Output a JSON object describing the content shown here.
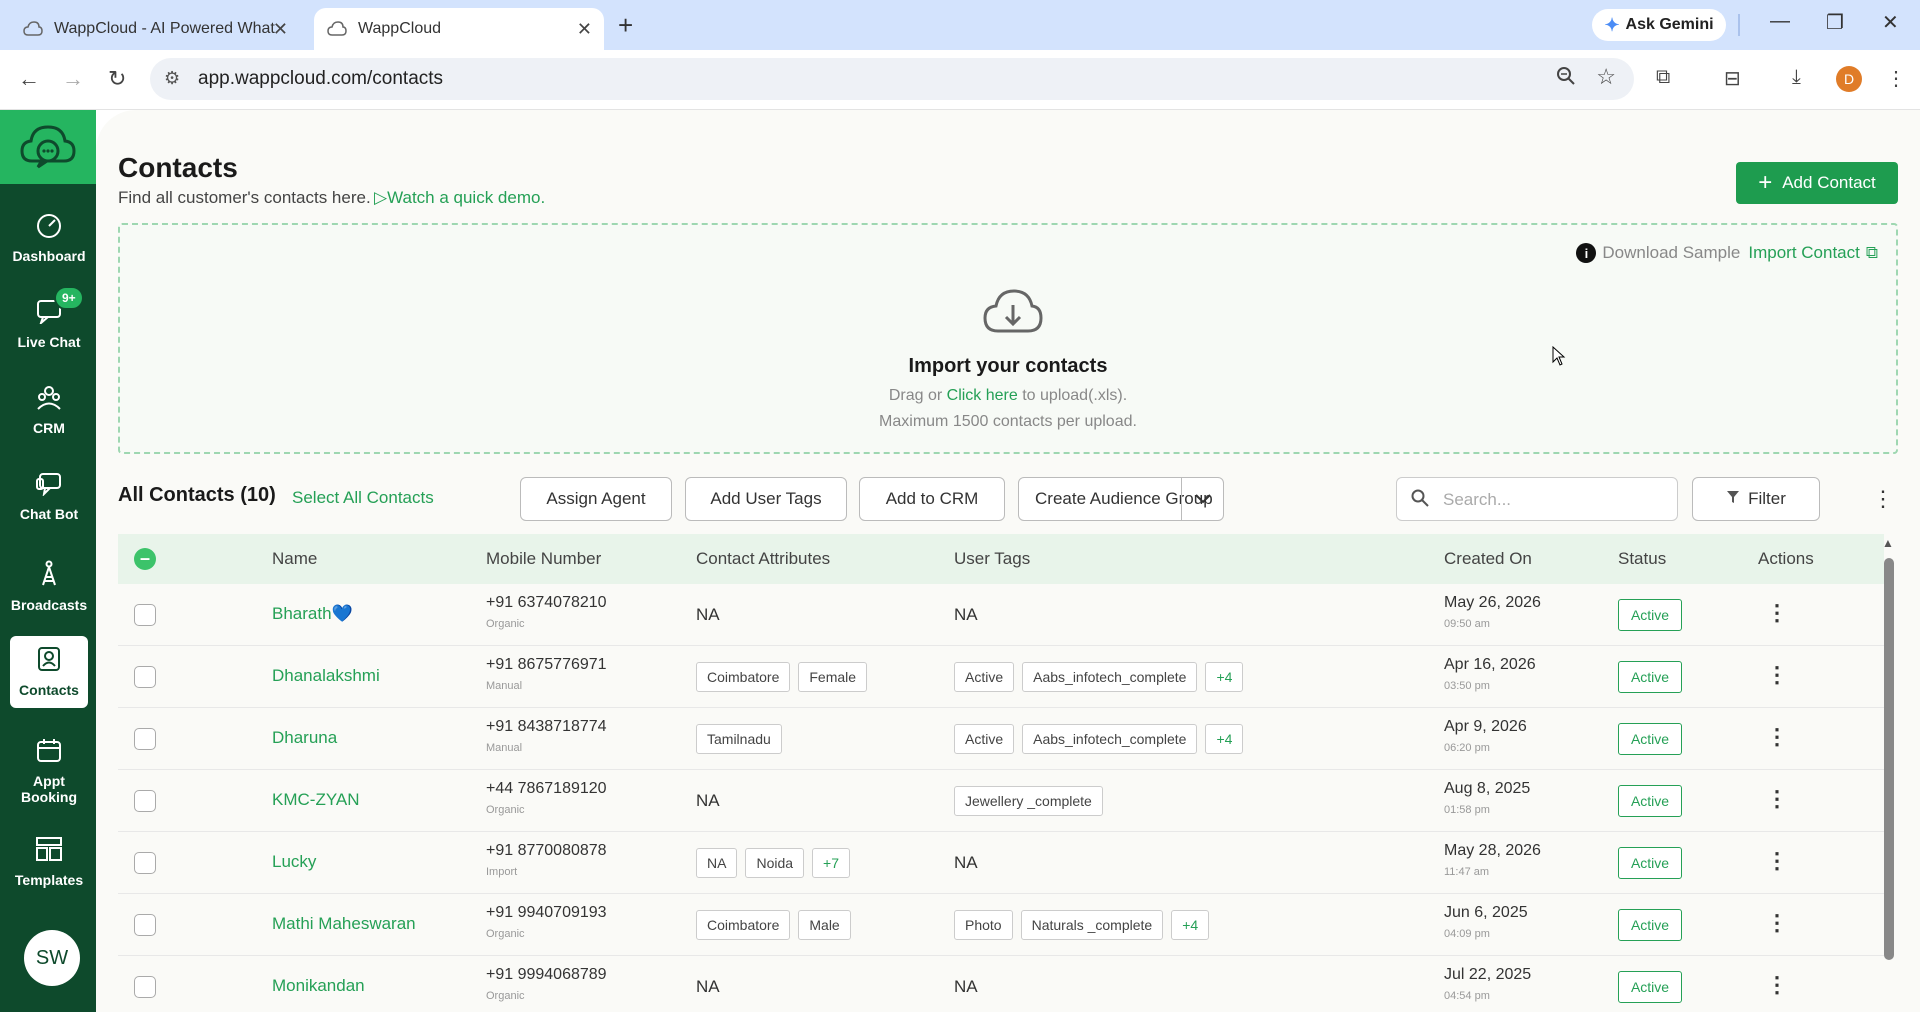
{
  "browser": {
    "tabs": [
      {
        "title": "WappCloud - AI Powered What"
      },
      {
        "title": "WappCloud"
      }
    ],
    "ask_gemini": "Ask Gemini",
    "url": "app.wappcloud.com/contacts",
    "profile_initial": "D"
  },
  "sidebar": {
    "items": [
      {
        "label": "Dashboard",
        "icon": "gauge-icon"
      },
      {
        "label": "Live Chat",
        "icon": "chat-icon",
        "badge": "9+"
      },
      {
        "label": "CRM",
        "icon": "people-icon"
      },
      {
        "label": "Chat Bot",
        "icon": "bot-icon"
      },
      {
        "label": "Broadcasts",
        "icon": "tower-icon"
      },
      {
        "label": "Contacts",
        "icon": "contacts-icon",
        "active": true
      },
      {
        "label": "Appt Booking",
        "icon": "calendar-icon"
      },
      {
        "label": "Templates",
        "icon": "grid-icon"
      }
    ],
    "avatar": "SW"
  },
  "header": {
    "title": "Contacts",
    "subtitle": "Find all customer's contacts here.",
    "demo_link": "Watch a quick demo.",
    "add_button": "Add Contact"
  },
  "import": {
    "download_sample": "Download Sample",
    "import_contact": "Import Contact",
    "title": "Import your contacts",
    "drag_prefix": "Drag or",
    "click_here": "Click here",
    "drag_suffix": "to upload(.xls).",
    "max_note": "Maximum 1500 contacts per upload."
  },
  "toolbar": {
    "all_contacts": "All Contacts (10)",
    "select_all": "Select All Contacts",
    "assign_agent": "Assign Agent",
    "add_user_tags": "Add User Tags",
    "add_to_crm": "Add to CRM",
    "create_audience_group": "Create Audience Group",
    "search_placeholder": "Search...",
    "filter": "Filter"
  },
  "table": {
    "columns": [
      "Name",
      "Mobile Number",
      "Contact Attributes",
      "User Tags",
      "Created On",
      "Status",
      "Actions"
    ],
    "rows": [
      {
        "name": "Bharath💙",
        "mobile": "+91 6374078210",
        "source": "Organic",
        "attributes": [],
        "tags": [],
        "date": "May 26, 2026",
        "time": "09:50 am",
        "status": "Active"
      },
      {
        "name": "Dhanalakshmi",
        "mobile": "+91 8675776971",
        "source": "Manual",
        "attributes": [
          "Coimbatore",
          "Female"
        ],
        "tags": [
          "Active",
          "Aabs_infotech_complete",
          "+4"
        ],
        "date": "Apr 16, 2026",
        "time": "03:50 pm",
        "status": "Active"
      },
      {
        "name": "Dharuna",
        "mobile": "+91 8438718774",
        "source": "Manual",
        "attributes": [
          "Tamilnadu"
        ],
        "tags": [
          "Active",
          "Aabs_infotech_complete",
          "+4"
        ],
        "date": "Apr 9, 2026",
        "time": "06:20 pm",
        "status": "Active"
      },
      {
        "name": "KMC-ZYAN",
        "mobile": "+44 7867189120",
        "source": "Organic",
        "attributes": [],
        "tags": [
          "Jewellery _complete"
        ],
        "date": "Aug 8, 2025",
        "time": "01:58 pm",
        "status": "Active"
      },
      {
        "name": "Lucky",
        "mobile": "+91 8770080878",
        "source": "Import",
        "attributes": [
          "NA",
          "Noida",
          "+7"
        ],
        "tags": [],
        "date": "May 28, 2026",
        "time": "11:47 am",
        "status": "Active"
      },
      {
        "name": "Mathi Maheswaran",
        "mobile": "+91 9940709193",
        "source": "Organic",
        "attributes": [
          "Coimbatore",
          "Male"
        ],
        "tags": [
          "Photo",
          "Naturals _complete",
          "+4"
        ],
        "date": "Jun 6, 2025",
        "time": "04:09 pm",
        "status": "Active"
      },
      {
        "name": "Monikandan",
        "mobile": "+91 9994068789",
        "source": "Organic",
        "attributes": [],
        "tags": [],
        "date": "Jul 22, 2025",
        "time": "04:54 pm",
        "status": "Active"
      }
    ],
    "empty_value": "NA"
  },
  "colors": {
    "brand_green": "#25a056",
    "sidebar_dark": "#0e4a2c",
    "button_green": "#1e9c4f"
  }
}
